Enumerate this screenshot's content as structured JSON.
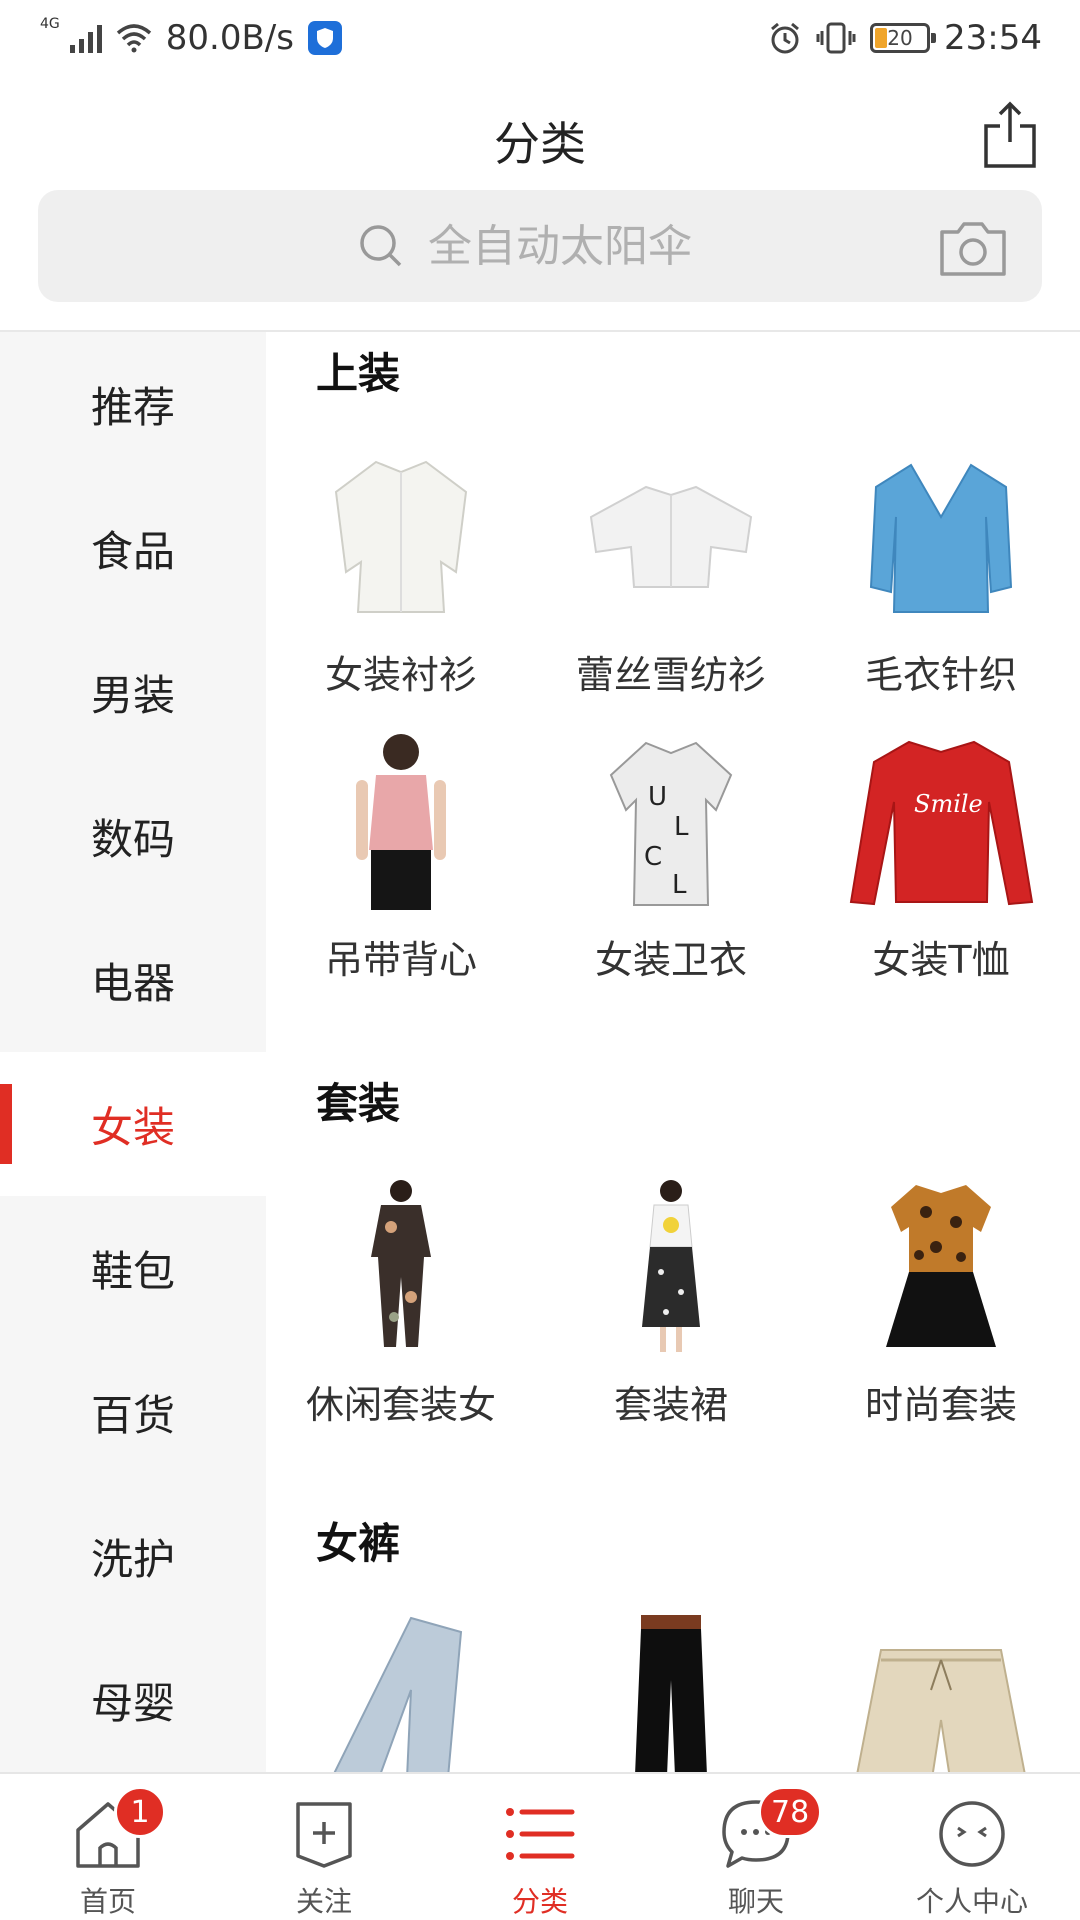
{
  "status_bar": {
    "network": "4G",
    "speed": "80.0B/s",
    "battery": "20",
    "time": "23:54"
  },
  "header": {
    "title": "分类"
  },
  "search": {
    "placeholder": "全自动太阳伞"
  },
  "sidebar": {
    "items": [
      {
        "label": "推荐",
        "active": false
      },
      {
        "label": "食品",
        "active": false
      },
      {
        "label": "男装",
        "active": false
      },
      {
        "label": "数码",
        "active": false
      },
      {
        "label": "电器",
        "active": false
      },
      {
        "label": "女装",
        "active": true
      },
      {
        "label": "鞋包",
        "active": false
      },
      {
        "label": "百货",
        "active": false
      },
      {
        "label": "洗护",
        "active": false
      },
      {
        "label": "母婴",
        "active": false
      }
    ]
  },
  "content": {
    "sections": [
      {
        "title": "上装",
        "items": [
          {
            "label": "女装衬衫",
            "image": "white-shirt"
          },
          {
            "label": "蕾丝雪纺衫",
            "image": "white-chiffon-top"
          },
          {
            "label": "毛衣针织",
            "image": "blue-cardigan"
          },
          {
            "label": "吊带背心",
            "image": "pink-tank-top"
          },
          {
            "label": "女装卫衣",
            "image": "letter-print-shirt"
          },
          {
            "label": "女装T恤",
            "image": "red-long-sleeve-tee"
          }
        ]
      },
      {
        "title": "套装",
        "items": [
          {
            "label": "休闲套装女",
            "image": "printed-set"
          },
          {
            "label": "套装裙",
            "image": "skirt-set"
          },
          {
            "label": "时尚套装",
            "image": "leopard-top-black-skirt"
          }
        ]
      },
      {
        "title": "女裤",
        "items": [
          {
            "label": "",
            "image": "light-jeans"
          },
          {
            "label": "",
            "image": "black-wide-pants"
          },
          {
            "label": "",
            "image": "khaki-shorts"
          }
        ]
      }
    ]
  },
  "bottom_nav": {
    "items": [
      {
        "label": "首页",
        "icon": "home-icon",
        "badge": "1",
        "active": false
      },
      {
        "label": "关注",
        "icon": "follow-icon",
        "badge": "",
        "active": false
      },
      {
        "label": "分类",
        "icon": "category-icon",
        "badge": "",
        "active": true
      },
      {
        "label": "聊天",
        "icon": "chat-icon",
        "badge": "78",
        "active": false
      },
      {
        "label": "个人中心",
        "icon": "profile-icon",
        "badge": "",
        "active": false
      }
    ]
  },
  "colors": {
    "accent": "#e02e24",
    "sidebar_bg": "#f6f6f6",
    "search_bg": "#efefef"
  }
}
